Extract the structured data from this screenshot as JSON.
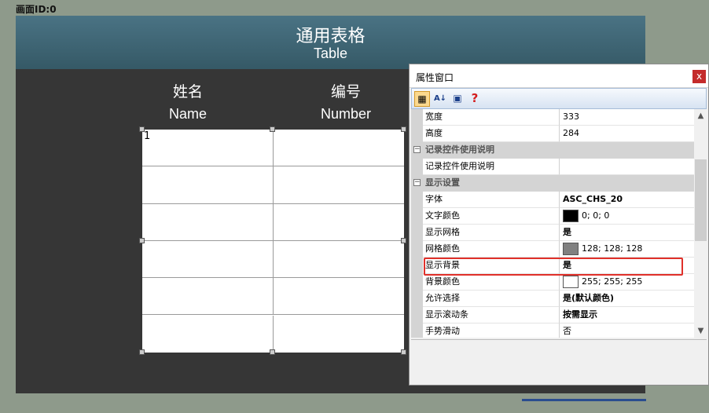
{
  "screen": {
    "id_label": "画面ID:0"
  },
  "canvas": {
    "title_cn": "通用表格",
    "title_en": "Table",
    "columns": [
      {
        "cn": "姓名",
        "en": "Name"
      },
      {
        "cn": "编号",
        "en": "Number"
      }
    ],
    "table": {
      "rows": 6,
      "cols": 2,
      "first_cell": "1",
      "grid_color": "#808080",
      "bg_color": "#FFFFFF"
    }
  },
  "props": {
    "title": "属性窗口",
    "close": "x",
    "toolbar": [
      {
        "name": "categorized-icon",
        "glyph": "▦"
      },
      {
        "name": "alphabetical-sort-icon",
        "glyph": "A↓"
      },
      {
        "name": "property-pages-icon",
        "glyph": "▣"
      },
      {
        "name": "help-icon",
        "glyph": "?"
      }
    ],
    "rows": [
      {
        "name": "宽度",
        "value": "333"
      },
      {
        "name": "高度",
        "value": "284"
      },
      {
        "category": "记录控件使用说明"
      },
      {
        "name": "记录控件使用说明",
        "value": ""
      },
      {
        "category": "显示设置"
      },
      {
        "name": "字体",
        "value": "ASC_CHS_20",
        "bold": true
      },
      {
        "name": "文字颜色",
        "value": "0; 0; 0",
        "swatch": "#000000"
      },
      {
        "name": "显示网格",
        "value": "是",
        "bold": true
      },
      {
        "name": "网格颜色",
        "value": "128; 128; 128",
        "swatch": "#808080"
      },
      {
        "name": "显示背景",
        "value": "是",
        "bold": true
      },
      {
        "name": "背景颜色",
        "value": "255; 255; 255",
        "swatch": "#FFFFFF"
      },
      {
        "name": "允许选择",
        "value": "是(默认颜色)",
        "bold": true
      },
      {
        "name": "显示滚动条",
        "value": "按需显示",
        "bold": true
      },
      {
        "name": "手势滑动",
        "value": "否"
      }
    ]
  },
  "colors": {
    "highlight": "#e0302a",
    "header": "#3d6573",
    "canvas": "#363636"
  }
}
